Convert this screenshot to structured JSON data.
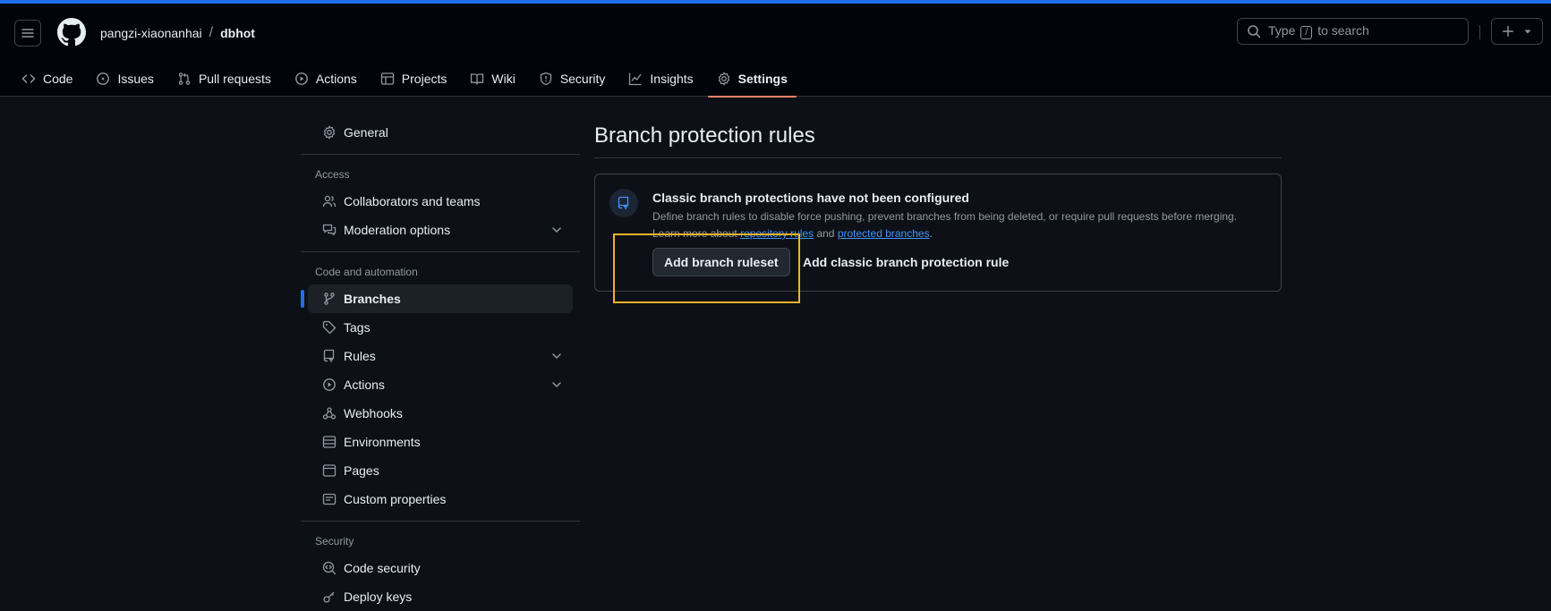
{
  "header": {
    "owner": "pangzi-xiaonanhai",
    "separator": "/",
    "repo": "dbhot",
    "search_prefix": "Type",
    "search_key": "/",
    "search_suffix": "to search",
    "plus_icon": "plus-icon",
    "menu_icon": "hamburger-icon",
    "logo_icon": "github-logo-icon"
  },
  "tabs": [
    {
      "label": "Code",
      "icon": "code-icon"
    },
    {
      "label": "Issues",
      "icon": "issue-icon"
    },
    {
      "label": "Pull requests",
      "icon": "pull-request-icon"
    },
    {
      "label": "Actions",
      "icon": "play-icon"
    },
    {
      "label": "Projects",
      "icon": "table-icon"
    },
    {
      "label": "Wiki",
      "icon": "book-icon"
    },
    {
      "label": "Security",
      "icon": "shield-icon"
    },
    {
      "label": "Insights",
      "icon": "graph-icon"
    },
    {
      "label": "Settings",
      "icon": "gear-icon",
      "active": true
    }
  ],
  "sidebar": {
    "general": "General",
    "access_heading": "Access",
    "collaborators": "Collaborators and teams",
    "moderation": "Moderation options",
    "code_heading": "Code and automation",
    "branches": "Branches",
    "tags": "Tags",
    "rules": "Rules",
    "actions": "Actions",
    "webhooks": "Webhooks",
    "environments": "Environments",
    "pages": "Pages",
    "custom_properties": "Custom properties",
    "security_heading": "Security",
    "code_security": "Code security",
    "deploy_keys_partial": "Deploy keys"
  },
  "main": {
    "title": "Branch protection rules",
    "box_title": "Classic branch protections have not been configured",
    "box_desc": "Define branch rules to disable force pushing, prevent branches from being deleted, or require pull requests before merging.",
    "learn_prefix": "Learn more about",
    "link_repo_rules": "repository rules",
    "and": "and",
    "link_protected": "protected branches",
    "period": ".",
    "btn_ruleset": "Add branch ruleset",
    "btn_classic": "Add classic branch protection rule"
  },
  "colors": {
    "accent": "#1f6feb",
    "tab_underline": "#f78166",
    "highlight": "#f0b429",
    "link": "#4493f8"
  }
}
